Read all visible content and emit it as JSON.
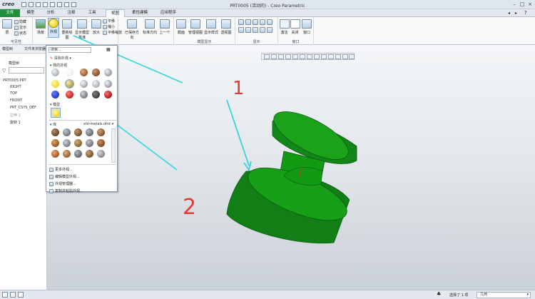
{
  "app": {
    "logo": "creo",
    "window_title": "PRT0005 (活动的) - Creo Parametric"
  },
  "tabs": [
    "文件",
    "模型",
    "分析",
    "注释",
    "工具",
    "视图",
    "柔性建模",
    "应用程序"
  ],
  "ribbon": {
    "visibility": {
      "label": "可见性",
      "button": "层",
      "small": [
        "隐藏",
        "显示",
        "状态"
      ]
    },
    "appearance": {
      "label": "外观",
      "buttons": [
        "场景",
        "外观",
        "重新绘图",
        "显示模型基准",
        "放大",
        "平移",
        "缩小",
        "平移缩放"
      ]
    },
    "orientation": {
      "buttons": [
        "已保存方向",
        "标准方向",
        "上一个"
      ]
    },
    "model_display": {
      "label": "模型显示",
      "buttons": [
        "截面",
        "管理视图",
        "显示样式",
        "透视图"
      ]
    },
    "display": {
      "label": "显示"
    },
    "window": {
      "label": "窗口",
      "buttons": [
        "激活",
        "关闭",
        "窗口"
      ]
    }
  },
  "sidebar": {
    "tabs": [
      "模型树",
      "文件夹浏览器"
    ],
    "header": "模型树",
    "items": [
      "PRT0005.PRT",
      "RIGHT",
      "TOP",
      "FRONT",
      "PRT_CSYS_DEF",
      "拉伸 1",
      "旋转 1"
    ]
  },
  "popup": {
    "search_placeholder": "搜索...",
    "clear": "清除外观",
    "my_appearances": "我的外观",
    "model": "模型",
    "library": "库",
    "library_file": "std-metals.dmt",
    "menu": [
      "更多外观...",
      "编辑模型外观...",
      "外观管理器...",
      "复制并粘贴外观..."
    ]
  },
  "annotations": [
    "1",
    "2"
  ],
  "status": {
    "selection": "选择了 1 项",
    "filter": "几何"
  },
  "colors": {
    "accent": "#1f8f3a",
    "model": "#169d16",
    "arrow": "#33d4dc",
    "annotation": "#e8392e"
  }
}
